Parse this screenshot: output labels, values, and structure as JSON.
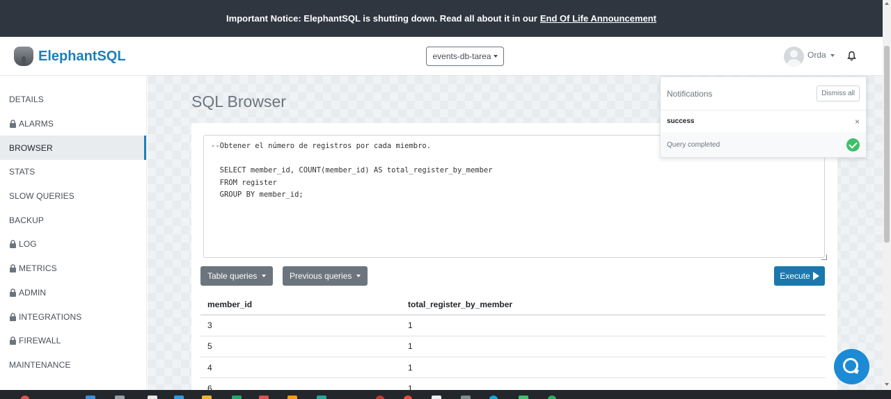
{
  "notice": {
    "text": "Important Notice: ElephantSQL is shutting down. Read all about it in our",
    "link": "End Of Life Announcement"
  },
  "header": {
    "brand": "ElephantSQL",
    "instance": "events-db-tarea",
    "user": "Orda"
  },
  "sidebar": {
    "items": [
      {
        "label": "DETAILS"
      },
      {
        "label": "ALARMS"
      },
      {
        "label": "BROWSER"
      },
      {
        "label": "STATS"
      },
      {
        "label": "SLOW QUERIES"
      },
      {
        "label": "BACKUP"
      },
      {
        "label": "LOG"
      },
      {
        "label": "METRICS"
      },
      {
        "label": "ADMIN"
      },
      {
        "label": "INTEGRATIONS"
      },
      {
        "label": "FIREWALL"
      },
      {
        "label": "MAINTENANCE"
      }
    ]
  },
  "main": {
    "title": "SQL Browser",
    "query": "--Obtener el número de registros por cada miembro.\n\n  SELECT member_id, COUNT(member_id) AS total_register_by_member\n  FROM register\n  GROUP BY member_id;",
    "table_queries_label": "Table queries",
    "previous_queries_label": "Previous queries",
    "execute_label": "Execute",
    "results": {
      "columns": [
        "member_id",
        "total_register_by_member"
      ],
      "rows": [
        [
          "3",
          "1"
        ],
        [
          "5",
          "1"
        ],
        [
          "4",
          "1"
        ],
        [
          "6",
          "1"
        ]
      ]
    }
  },
  "notifications": {
    "title": "Notifications",
    "dismiss_label": "Dismiss all",
    "items": [
      {
        "type": "success",
        "close": "×",
        "message": "Query completed"
      }
    ]
  },
  "colors": {
    "notice_bg": "#2f3640",
    "brand": "#1f7fb8",
    "execute": "#1a78ad",
    "secondary_button": "#6c757d",
    "success": "#3fbf6b",
    "chat": "#1c8ad4"
  }
}
